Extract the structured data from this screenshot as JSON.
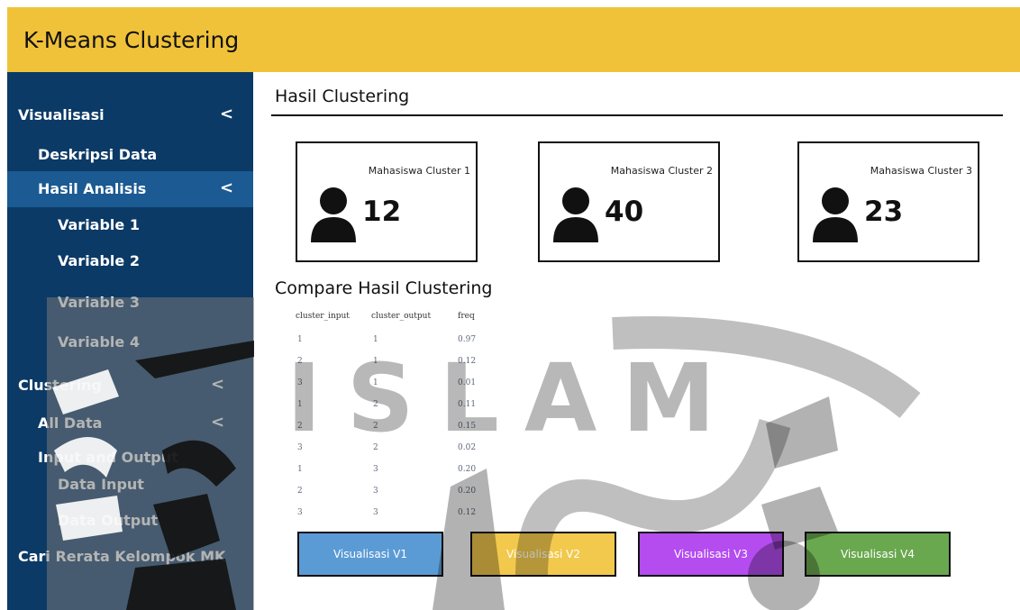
{
  "header": {
    "title": "K-Means Clustering"
  },
  "sidebar": {
    "items": [
      {
        "label": "Visualisasi",
        "chevron": "<"
      },
      {
        "label": "Deskripsi Data",
        "chevron": ""
      },
      {
        "label": "Hasil Analisis",
        "chevron": "<"
      },
      {
        "label": "Variable 1",
        "chevron": ""
      },
      {
        "label": "Variable 2",
        "chevron": ""
      },
      {
        "label": "Variable 3",
        "chevron": ""
      },
      {
        "label": "Variable 4",
        "chevron": ""
      },
      {
        "label": "Clustering",
        "chevron": "<"
      },
      {
        "label": "All Data",
        "chevron": "<"
      },
      {
        "label": "Input and Output",
        "chevron": ""
      },
      {
        "label": "Data Input",
        "chevron": ""
      },
      {
        "label": "Data Output",
        "chevron": ""
      },
      {
        "label": "Cari Rerata Kelompok MK",
        "chevron": ""
      }
    ]
  },
  "main": {
    "title": "Hasil Clustering",
    "cards": [
      {
        "label": "Mahasiswa Cluster 1",
        "value": "12",
        "icon": "user-icon"
      },
      {
        "label": "Mahasiswa Cluster 2",
        "value": "40",
        "icon": "user-icon"
      },
      {
        "label": "Mahasiswa Cluster 3",
        "value": "23",
        "icon": "user-icon"
      }
    ],
    "compare": {
      "title": "Compare Hasil Clustering",
      "columns": [
        "cluster_input",
        "cluster_output",
        "freq"
      ],
      "rows": [
        [
          "1",
          "1",
          "0.97"
        ],
        [
          "2",
          "1",
          "0.12"
        ],
        [
          "3",
          "1",
          "0.01"
        ],
        [
          "1",
          "2",
          "0.11"
        ],
        [
          "2",
          "2",
          "0.15"
        ],
        [
          "3",
          "2",
          "0.02"
        ],
        [
          "1",
          "3",
          "0.20"
        ],
        [
          "2",
          "3",
          "0.20"
        ],
        [
          "3",
          "3",
          "0.12"
        ]
      ]
    },
    "buttons": [
      {
        "label": "Visualisasi V1",
        "color": "#5b9bd5"
      },
      {
        "label": "Visualisasi V2",
        "color": "#f2c94c"
      },
      {
        "label": "Visualisasi V3",
        "color": "#b44cf0"
      },
      {
        "label": "Visualisasi V4",
        "color": "#6aa84f"
      }
    ]
  },
  "watermark": {
    "text": "ISLAM"
  }
}
